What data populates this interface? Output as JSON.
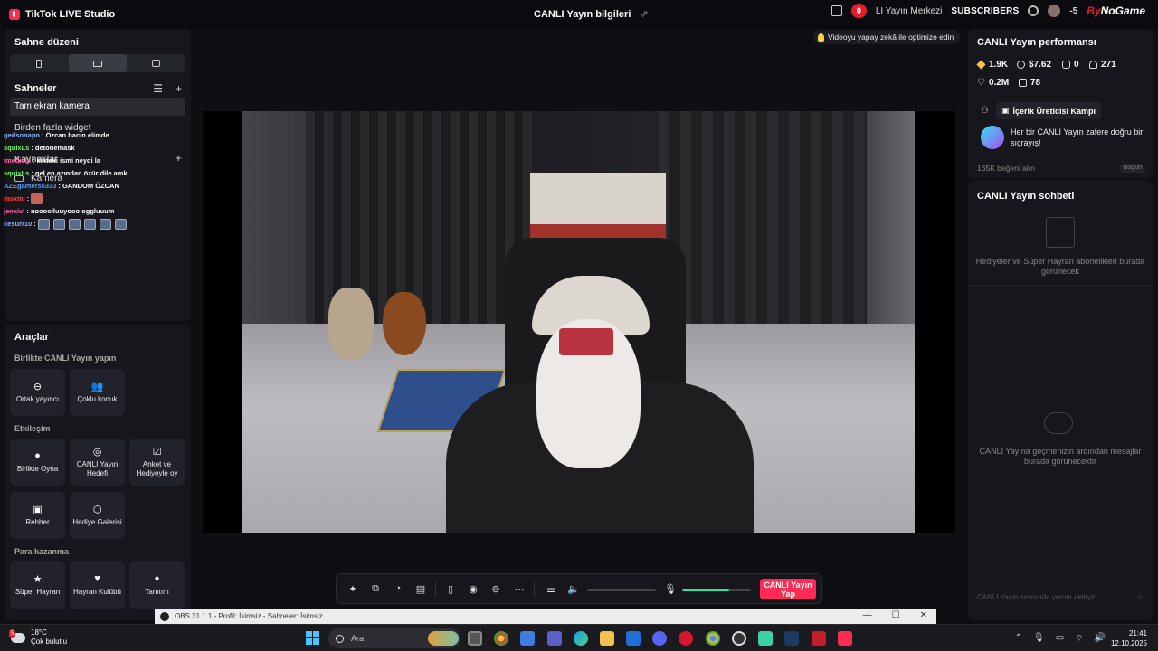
{
  "titlebar": {
    "app_name": "TikTok LIVE Studio",
    "center_title": "CANLI Yayın bilgileri",
    "notif_count": "0",
    "center_link": "LI Yayın Merkezi",
    "subscribers": "SUBSCRIBERS",
    "minus_five": "-5",
    "brand_prefix": "By",
    "brand_suffix": "NoGame"
  },
  "left": {
    "scene_layout_title": "Sahne düzeni",
    "scenes_title": "Sahneler",
    "active_scene": "Tam ekran kamera",
    "scene_item": "Birden fazla widget",
    "sources_title": "Kaynaklar",
    "camera_label": "Kamera"
  },
  "chat_overlay": [
    {
      "user": "gedsonapo",
      "color": "#8fb3ff",
      "msg": ": Özcan bacın elimde"
    },
    {
      "user": "squixLs",
      "color": "#7df36a",
      "msg": ": detonemask"
    },
    {
      "user": "Imedicla",
      "color": "#ff6aa8",
      "msg": ": kikteki ismi neydi la"
    },
    {
      "user": "squixLs",
      "color": "#7df36a",
      "msg": ": gel en azından özür dile amk"
    },
    {
      "user": "AZEgamers5333",
      "color": "#4ea1ff",
      "msg": ": GANDOM ÖZCAN"
    },
    {
      "user": "msxmi",
      "color": "#ff4444",
      "msg": ":"
    },
    {
      "user": "jenxivl",
      "color": "#ff6aa8",
      "msg": ": noooolluuyooo oggluuum"
    },
    {
      "user": "cesurr10",
      "color": "#8fb3ff",
      "msg": ":"
    }
  ],
  "tools": {
    "title": "Araçlar",
    "section_together": "Birlikte CANLI Yayın yapın",
    "section_interaction": "Etkileşim",
    "section_monetize": "Para kazanma",
    "items": {
      "cohost": "Ortak yayıncı",
      "multi_guest": "Çoklu konuk",
      "play_together": "Birlikte Oyna",
      "live_goal": "CANLI Yayın Hedefi",
      "poll": "Anket ve Hediyeyle oy",
      "guide": "Rehber",
      "gift_gallery": "Hediye Galerisi",
      "super_fan": "Süper Hayran",
      "fan_club": "Hayran Kulübü",
      "promote": "Tanıtım"
    }
  },
  "center": {
    "ai_badge": "Videoyu yapay zekâ ile optimize edin",
    "go_live_line1": "CANLI Yayın",
    "go_live_line2": "Yap",
    "mic_level": 0.68
  },
  "right": {
    "perf_title": "CANLI Yayın performansı",
    "diamonds": "1.9K",
    "earnings": "$7.62",
    "new_followers": "0",
    "viewers": "271",
    "likes": "0.2M",
    "gifts": "78",
    "camp_button": "İçerik Üreticisi Kampı",
    "camp_text": "Her bir CANLI Yayın zafere doğru bir sıçrayış!",
    "likes_summary": "165K beğeni alın",
    "today": "Bugün",
    "chat_title": "CANLI Yayın sohbeti",
    "gifts_empty": "Hediyeler ve Süper Hayran abonelikleri burada görünecek",
    "chat_empty": "CANLI Yayına geçmenizin ardından mesajlar burada görünecektir",
    "chat_input_placeholder": "CANLI Yayın sırasında yorum ekleyin"
  },
  "obs": {
    "text": "OBS 31.1.1 - Profil: İsimsiz - Sahneler: İsimsiz"
  },
  "taskbar": {
    "temperature": "18°C",
    "weather": "Çok bulutlu",
    "weather_badge": "5",
    "search_placeholder": "Ara",
    "time": "21:41",
    "date": "12.10.2025"
  },
  "colors": {
    "accent": "#fe2c55",
    "mic_green": "#2ee59d",
    "panel": "#16161c"
  }
}
